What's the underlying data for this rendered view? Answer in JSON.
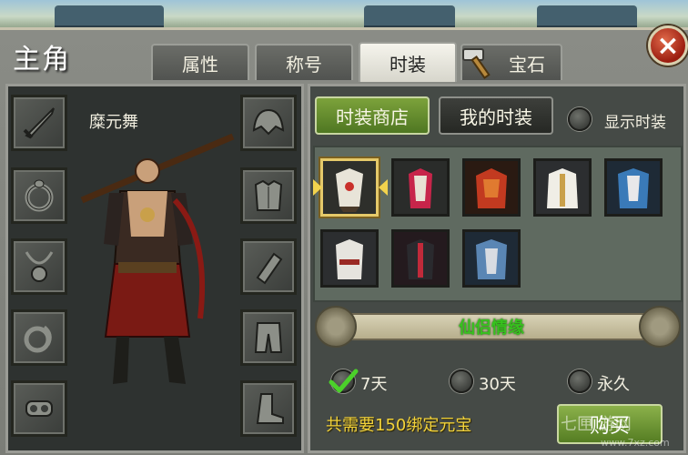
{
  "window": {
    "title": "主角",
    "close_label": "×"
  },
  "tabs": [
    {
      "label": "属性",
      "active": false
    },
    {
      "label": "称号",
      "active": false
    },
    {
      "label": "时装",
      "active": true
    },
    {
      "label": "宝石",
      "active": false
    }
  ],
  "character": {
    "name": "糜元舞"
  },
  "equipment_slots": {
    "left": [
      "sword-icon",
      "ring-icon",
      "necklace-icon",
      "jade-pendant-icon",
      "amulet-icon"
    ],
    "right": [
      "helmet-icon",
      "armor-icon",
      "bracer-icon",
      "pants-icon",
      "boots-icon"
    ]
  },
  "fashion": {
    "shop_button": "时装商店",
    "my_button": "我的时装",
    "show_toggle_label": "显示时装",
    "items": [
      {
        "icon": "costume-icon",
        "selected": true
      },
      {
        "icon": "costume-icon",
        "selected": false
      },
      {
        "icon": "costume-icon",
        "selected": false
      },
      {
        "icon": "costume-icon",
        "selected": false
      },
      {
        "icon": "costume-icon",
        "selected": false
      },
      {
        "icon": "costume-icon",
        "selected": false
      },
      {
        "icon": "costume-icon",
        "selected": false
      },
      {
        "icon": "costume-icon",
        "selected": false
      }
    ],
    "set_name": "仙侣情缘",
    "durations": [
      {
        "label": "7天",
        "checked": true
      },
      {
        "label": "30天",
        "checked": false
      },
      {
        "label": "永久",
        "checked": false
      }
    ],
    "cost_text": "共需要150绑定元宝",
    "buy_button": "购买"
  },
  "watermark": {
    "text": "七匣 游网",
    "url": "www.7xz.com"
  },
  "colors": {
    "accent_green": "#6c9a33",
    "gold_text": "#f2d23a",
    "set_name_green": "#37c21e",
    "close_red": "#9b1d10"
  }
}
